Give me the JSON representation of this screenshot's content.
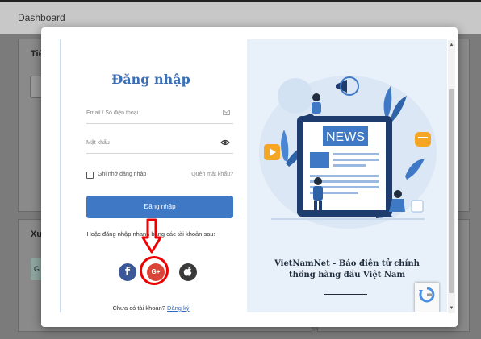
{
  "background": {
    "header_title": "Dashboard",
    "card1_label": "Tiế",
    "card2_label": "Xu",
    "chip_text": "G"
  },
  "login": {
    "title": "Đăng nhập",
    "email_placeholder": "Email / Số điện thoại",
    "password_placeholder": "Mật khẩu",
    "remember_label": "Ghi nhớ đăng nhập",
    "forgot_link": "Quên mật khẩu?",
    "submit_label": "Đăng nhập",
    "social_prompt": "Hoặc đăng nhập nhanh bằng các tài khoản sau:",
    "social": [
      {
        "name": "facebook",
        "glyph": "f",
        "color": "#3b5998"
      },
      {
        "name": "google-plus",
        "glyph": "G+",
        "color": "#db4437"
      },
      {
        "name": "apple",
        "glyph": "",
        "color": "#3a3a3a"
      }
    ],
    "signup_prompt": "Chưa có tài khoản?",
    "signup_link": "Đăng ký"
  },
  "promo": {
    "news_label": "NEWS",
    "caption_line1": "VietNamNet - Báo điện tử chính",
    "caption_line2": "thống hàng đầu Việt Nam"
  },
  "colors": {
    "accent": "#3f79c6",
    "title": "#3b6fb6",
    "annotation": "#e00000"
  }
}
